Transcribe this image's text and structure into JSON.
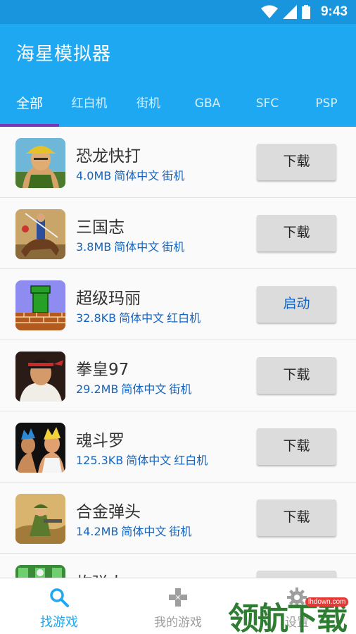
{
  "status_bar": {
    "time": "9:43"
  },
  "app": {
    "title": "海星模拟器"
  },
  "tabs": [
    {
      "label": "全部",
      "active": true
    },
    {
      "label": "红白机",
      "active": false
    },
    {
      "label": "街机",
      "active": false
    },
    {
      "label": "GBA",
      "active": false
    },
    {
      "label": "SFC",
      "active": false
    },
    {
      "label": "PSP",
      "active": false
    }
  ],
  "games": [
    {
      "name": "恐龙快打",
      "size": "4.0MB",
      "language": "简体中文",
      "platform": "街机",
      "button": "下载"
    },
    {
      "name": "三国志",
      "size": "3.8MB",
      "language": "简体中文",
      "platform": "街机",
      "button": "下载"
    },
    {
      "name": "超级玛丽",
      "size": "32.8KB",
      "language": "简体中文",
      "platform": "红白机",
      "button": "启动"
    },
    {
      "name": "拳皇97",
      "size": "29.2MB",
      "language": "简体中文",
      "platform": "街机",
      "button": "下载"
    },
    {
      "name": "魂斗罗",
      "size": "125.3KB",
      "language": "简体中文",
      "platform": "红白机",
      "button": "下载"
    },
    {
      "name": "合金弹头",
      "size": "14.2MB",
      "language": "简体中文",
      "platform": "街机",
      "button": "下载"
    },
    {
      "name": "炸弹人",
      "size": "",
      "language": "",
      "platform": "",
      "button": ""
    }
  ],
  "bottom_nav": [
    {
      "label": "找游戏",
      "icon": "search-icon",
      "active": true
    },
    {
      "label": "我的游戏",
      "icon": "gamepad-icon",
      "active": false
    },
    {
      "label": "设置",
      "icon": "gear-icon",
      "active": false
    }
  ],
  "watermark": {
    "url": "lhdown.com",
    "text": "领航下载"
  },
  "colors": {
    "appbar": "#1ea8f2",
    "statusbar": "#1995dd",
    "accent": "#1565c0",
    "tab_indicator": "#7a35b8"
  }
}
